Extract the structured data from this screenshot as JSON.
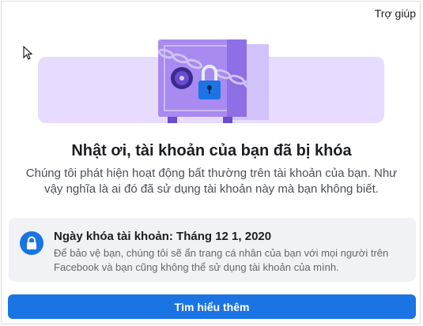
{
  "header": {
    "help_link": "Trợ giúp"
  },
  "hero": {
    "illustration": "locked-safe-icon"
  },
  "main": {
    "title": "Nhật ơi, tài khoản của bạn đã bị khóa",
    "description": "Chúng tôi phát hiện hoạt động bất thường trên tài khoản của bạn. Như vậy nghĩa là ai đó đã sử dụng tài khoản này mà bạn không biết."
  },
  "notice": {
    "icon": "lock-icon",
    "title": "Ngày khóa tài khoản: Tháng 12 1, 2020",
    "text": "Để bảo vệ bạn, chúng tôi sẽ ẩn trang cá nhân của bạn với mọi người trên Facebook và bạn cũng không thể sử dụng tài khoản của mình."
  },
  "actions": {
    "learn_more": "Tìm hiểu thêm"
  },
  "colors": {
    "accent": "#1b74e4",
    "hero_bg": "#e7dcff",
    "safe": "#a98af0"
  }
}
